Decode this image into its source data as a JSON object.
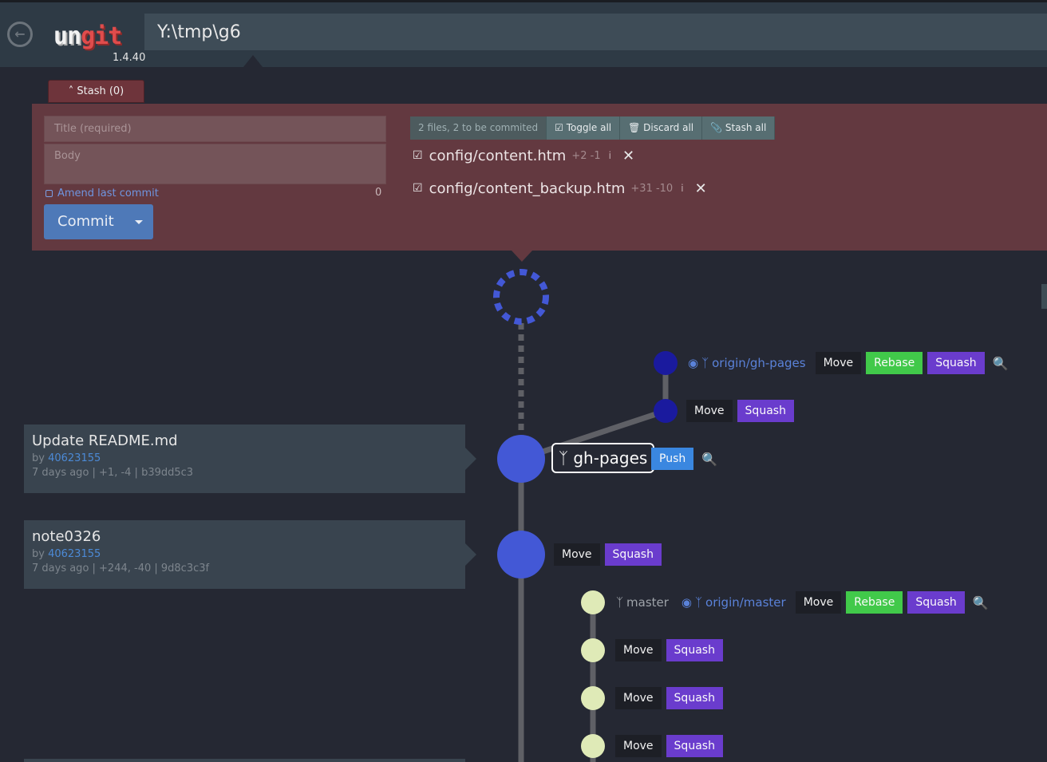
{
  "header": {
    "logo_un": "un",
    "logo_git": "git",
    "version": "1.4.40",
    "repo_path": "Y:\\tmp\\g6",
    "back_icon": "arrow-left-circle-icon"
  },
  "stash": {
    "label": "Stash (0)"
  },
  "staging": {
    "title_placeholder": "Title (required)",
    "body_placeholder": "Body",
    "amend_label": "Amend last commit",
    "char_count": "0",
    "commit_label": "Commit",
    "files_summary": "2 files, 2 to be commited",
    "toggle_all": "Toggle all",
    "discard_all": "Discard all",
    "stash_all": "Stash all",
    "files": [
      {
        "name": "config/content.htm",
        "stat": "+2 -1",
        "info": "i"
      },
      {
        "name": "config/content_backup.htm",
        "stat": "+31 -10",
        "info": "i"
      }
    ]
  },
  "graph": {
    "origin_gh_pages": "origin/gh-pages",
    "gh_pages": "gh-pages",
    "master": "master",
    "origin_master": "origin/master",
    "move": "Move",
    "rebase": "Rebase",
    "squash": "Squash",
    "push": "Push"
  },
  "commits": [
    {
      "message": "Update README.md",
      "by": "by",
      "author": "40623155",
      "meta": "7 days ago | +1, -4 | b39dd5c3"
    },
    {
      "message": "note0326",
      "by": "by",
      "author": "40623155",
      "meta": "7 days ago | +244, -40 | 9d8c3c3f"
    }
  ],
  "colors": {
    "header_bg": "#2e3a45",
    "staging_bg": "#633940",
    "main_node": "#4358d6",
    "remote_node": "#1a1a9e",
    "master_node": "#dfeab7",
    "rebase": "#41c94a",
    "squash": "#6a3ccd",
    "push": "#3a87e0"
  }
}
